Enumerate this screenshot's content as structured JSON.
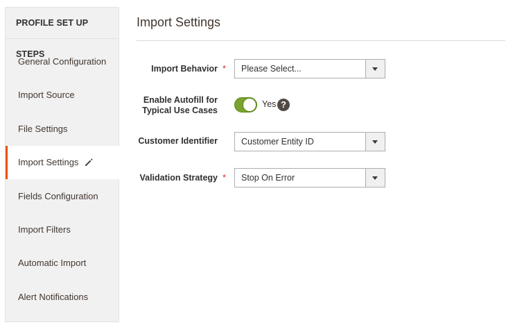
{
  "sidebar": {
    "title": "PROFILE SET UP STEPS",
    "items": [
      {
        "label": "General Configuration"
      },
      {
        "label": "Import Source"
      },
      {
        "label": "File Settings"
      },
      {
        "label": "Import Settings"
      },
      {
        "label": "Fields Configuration"
      },
      {
        "label": "Import Filters"
      },
      {
        "label": "Automatic Import"
      },
      {
        "label": "Alert Notifications"
      }
    ],
    "active_item": "Import Settings",
    "active_icon": "pencil-icon"
  },
  "main": {
    "title": "Import Settings",
    "fields": {
      "import_behavior": {
        "label": "Import Behavior",
        "required": "*",
        "value": "Please Select..."
      },
      "enable_autofill": {
        "label_line1": "Enable Autofill for",
        "label_line2": "Typical Use Cases",
        "toggle_state": "Yes",
        "help": "?"
      },
      "customer_identifier": {
        "label": "Customer Identifier",
        "value": "Customer Entity ID"
      },
      "validation_strategy": {
        "label": "Validation Strategy",
        "required": "*",
        "value": "Stop On Error"
      }
    }
  },
  "colors": {
    "accent": "#eb5202",
    "toggle_on": "#79a22e",
    "required": "#e22626"
  }
}
